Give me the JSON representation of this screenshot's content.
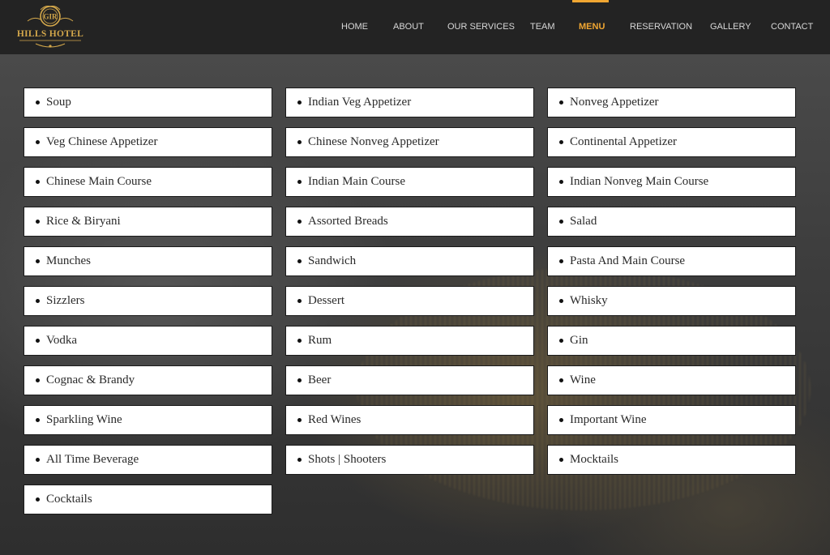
{
  "brand": {
    "monogram": "GIR",
    "name": "HILLS HOTEL",
    "accent_color": "#d4a84b"
  },
  "nav": {
    "active_color": "#f0a632",
    "items": [
      {
        "label": "HOME"
      },
      {
        "label": "ABOUT"
      },
      {
        "label": "OUR SERVICES"
      },
      {
        "label": "TEAM"
      },
      {
        "label": "MENU",
        "active": true
      },
      {
        "label": "RESERVATION"
      },
      {
        "label": "GALLERY"
      },
      {
        "label": "CONTACT"
      }
    ]
  },
  "menu_categories": [
    "Soup",
    "Indian Veg Appetizer",
    "Nonveg Appetizer",
    "Veg Chinese Appetizer",
    "Chinese Nonveg Appetizer",
    "Continental Appetizer",
    "Chinese Main Course",
    "Indian Main Course",
    "Indian Nonveg Main Course",
    "Rice & Biryani",
    "Assorted Breads",
    "Salad",
    "Munches",
    "Sandwich",
    "Pasta And Main Course",
    "Sizzlers",
    "Dessert",
    "Whisky",
    "Vodka",
    "Rum",
    "Gin",
    "Cognac & Brandy",
    "Beer",
    "Wine",
    "Sparkling Wine",
    "Red Wines",
    "Important Wine",
    "All Time Beverage",
    "Shots | Shooters",
    "Mocktails",
    "Cocktails"
  ]
}
